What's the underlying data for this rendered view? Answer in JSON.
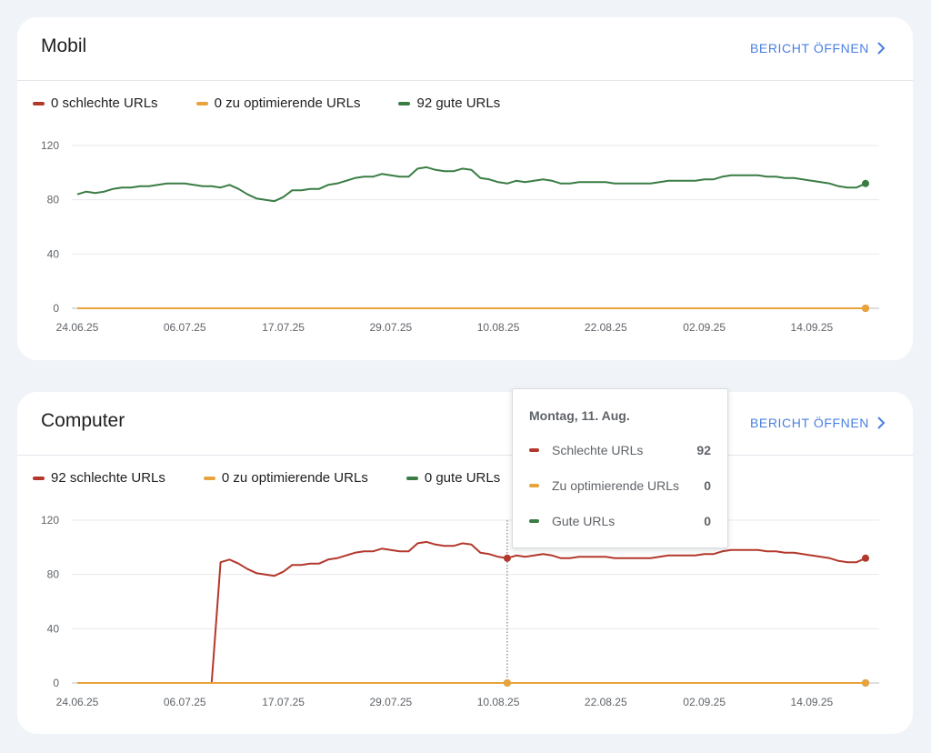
{
  "colors": {
    "bad": "#b3382c",
    "needs": "#e8a33d",
    "good": "#3a7d44",
    "link": "#4a7fe0"
  },
  "cards": [
    {
      "title": "Mobil",
      "link_label": "BERICHT ÖFFNEN",
      "legend": [
        "0 schlechte URLs",
        "0 zu optimierende URLs",
        "92 gute URLs"
      ]
    },
    {
      "title": "Computer",
      "link_label": "BERICHT ÖFFNEN",
      "legend": [
        "92 schlechte URLs",
        "0 zu optimierende URLs",
        "0 gute URLs"
      ]
    }
  ],
  "tooltip": {
    "date": "Montag, 11. Aug.",
    "rows": [
      {
        "label": "Schlechte URLs",
        "value": "92"
      },
      {
        "label": "Zu optimierende URLs",
        "value": "0"
      },
      {
        "label": "Gute URLs",
        "value": "0"
      }
    ]
  },
  "chart_data": [
    {
      "type": "line",
      "title": "Mobil",
      "ylim": [
        0,
        120
      ],
      "yticks": [
        "0",
        "40",
        "80",
        "120"
      ],
      "xticks": [
        "24.06.25",
        "06.07.25",
        "17.07.25",
        "29.07.25",
        "10.08.25",
        "22.08.25",
        "02.09.25",
        "14.09.25"
      ],
      "grid": true,
      "x_start": "24.06.25",
      "x_end": "20.09.25",
      "series": [
        {
          "name": "Schlechte URLs",
          "color": "#b3382c",
          "values": [
            0,
            0,
            0,
            0,
            0,
            0,
            0,
            0,
            0,
            0,
            0,
            0,
            0,
            0,
            0,
            0,
            0,
            0,
            0,
            0,
            0,
            0,
            0,
            0,
            0,
            0,
            0,
            0,
            0,
            0,
            0,
            0,
            0,
            0,
            0,
            0,
            0,
            0,
            0,
            0,
            0,
            0,
            0,
            0,
            0,
            0,
            0,
            0,
            0,
            0,
            0,
            0,
            0,
            0,
            0,
            0,
            0,
            0,
            0,
            0,
            0,
            0,
            0,
            0,
            0,
            0,
            0,
            0,
            0,
            0,
            0,
            0,
            0,
            0,
            0,
            0,
            0,
            0,
            0,
            0,
            0,
            0,
            0,
            0,
            0,
            0,
            0,
            0,
            0
          ]
        },
        {
          "name": "Zu optimierende URLs",
          "color": "#e8a33d",
          "values": [
            0,
            0,
            0,
            0,
            0,
            0,
            0,
            0,
            0,
            0,
            0,
            0,
            0,
            0,
            0,
            0,
            0,
            0,
            0,
            0,
            0,
            0,
            0,
            0,
            0,
            0,
            0,
            0,
            0,
            0,
            0,
            0,
            0,
            0,
            0,
            0,
            0,
            0,
            0,
            0,
            0,
            0,
            0,
            0,
            0,
            0,
            0,
            0,
            0,
            0,
            0,
            0,
            0,
            0,
            0,
            0,
            0,
            0,
            0,
            0,
            0,
            0,
            0,
            0,
            0,
            0,
            0,
            0,
            0,
            0,
            0,
            0,
            0,
            0,
            0,
            0,
            0,
            0,
            0,
            0,
            0,
            0,
            0,
            0,
            0,
            0,
            0,
            0,
            0
          ]
        },
        {
          "name": "Gute URLs",
          "color": "#3a7d44",
          "values": [
            84,
            86,
            85,
            86,
            88,
            89,
            89,
            90,
            90,
            91,
            92,
            92,
            92,
            91,
            90,
            90,
            89,
            91,
            88,
            84,
            81,
            80,
            79,
            82,
            87,
            87,
            88,
            88,
            91,
            92,
            94,
            96,
            97,
            97,
            99,
            98,
            97,
            97,
            103,
            104,
            102,
            101,
            101,
            103,
            102,
            96,
            95,
            93,
            92,
            94,
            93,
            94,
            95,
            94,
            92,
            92,
            93,
            93,
            93,
            93,
            92,
            92,
            92,
            92,
            92,
            93,
            94,
            94,
            94,
            94,
            95,
            95,
            97,
            98,
            98,
            98,
            98,
            97,
            97,
            96,
            96,
            95,
            94,
            93,
            92,
            90,
            89,
            89,
            92
          ]
        }
      ]
    },
    {
      "type": "line",
      "title": "Computer",
      "ylim": [
        0,
        120
      ],
      "yticks": [
        "0",
        "40",
        "80",
        "120"
      ],
      "xticks": [
        "24.06.25",
        "06.07.25",
        "17.07.25",
        "29.07.25",
        "10.08.25",
        "22.08.25",
        "02.09.25",
        "14.09.25"
      ],
      "grid": true,
      "x_start": "24.06.25",
      "x_end": "20.09.25",
      "hover_date": "11.08.25",
      "series": [
        {
          "name": "Schlechte URLs",
          "color": "#b3382c",
          "values": [
            0,
            0,
            0,
            0,
            0,
            0,
            0,
            0,
            0,
            0,
            0,
            0,
            0,
            0,
            0,
            0,
            89,
            91,
            88,
            84,
            81,
            80,
            79,
            82,
            87,
            87,
            88,
            88,
            91,
            92,
            94,
            96,
            97,
            97,
            99,
            98,
            97,
            97,
            103,
            104,
            102,
            101,
            101,
            103,
            102,
            96,
            95,
            93,
            92,
            94,
            93,
            94,
            95,
            94,
            92,
            92,
            93,
            93,
            93,
            93,
            92,
            92,
            92,
            92,
            92,
            93,
            94,
            94,
            94,
            94,
            95,
            95,
            97,
            98,
            98,
            98,
            98,
            97,
            97,
            96,
            96,
            95,
            94,
            93,
            92,
            90,
            89,
            89,
            92
          ]
        },
        {
          "name": "Gute URLs",
          "color": "#3a7d44",
          "values": [
            0,
            0,
            0,
            0,
            0,
            0,
            0,
            0,
            0,
            0,
            0,
            0,
            0,
            0,
            0,
            0,
            0,
            0,
            0,
            0,
            0,
            0,
            0,
            0,
            0,
            0,
            0,
            0,
            0,
            0,
            0,
            0,
            0,
            0,
            0,
            0,
            0,
            0,
            0,
            0,
            0,
            0,
            0,
            0,
            0,
            0,
            0,
            0,
            0,
            0,
            0,
            0,
            0,
            0,
            0,
            0,
            0,
            0,
            0,
            0,
            0,
            0,
            0,
            0,
            0,
            0,
            0,
            0,
            0,
            0,
            0,
            0,
            0,
            0,
            0,
            0,
            0,
            0,
            0,
            0,
            0,
            0,
            0,
            0,
            0,
            0,
            0,
            0,
            0
          ]
        },
        {
          "name": "Zu optimierende URLs",
          "color": "#e8a33d",
          "values": [
            0,
            0,
            0,
            0,
            0,
            0,
            0,
            0,
            0,
            0,
            0,
            0,
            0,
            0,
            0,
            0,
            0,
            0,
            0,
            0,
            0,
            0,
            0,
            0,
            0,
            0,
            0,
            0,
            0,
            0,
            0,
            0,
            0,
            0,
            0,
            0,
            0,
            0,
            0,
            0,
            0,
            0,
            0,
            0,
            0,
            0,
            0,
            0,
            0,
            0,
            0,
            0,
            0,
            0,
            0,
            0,
            0,
            0,
            0,
            0,
            0,
            0,
            0,
            0,
            0,
            0,
            0,
            0,
            0,
            0,
            0,
            0,
            0,
            0,
            0,
            0,
            0,
            0,
            0,
            0,
            0,
            0,
            0,
            0,
            0,
            0,
            0,
            0,
            0
          ]
        }
      ]
    }
  ]
}
